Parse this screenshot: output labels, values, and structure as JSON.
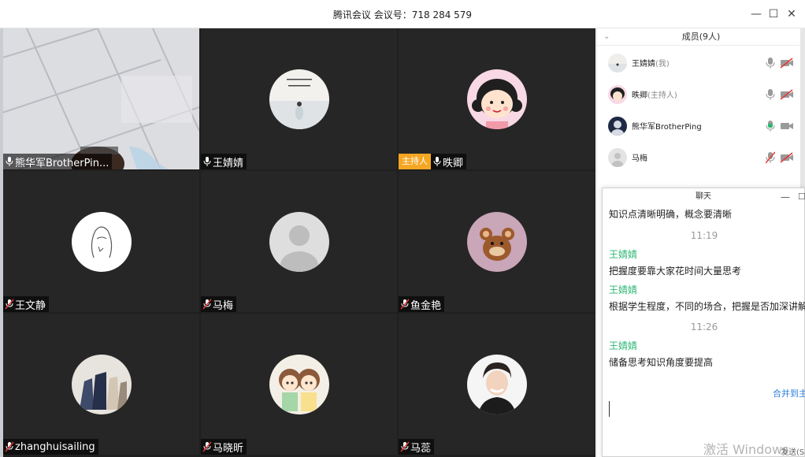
{
  "window": {
    "title": "腾讯会议 会议号：718 284 579",
    "minimize": "—",
    "maximize": "☐",
    "close": "✕"
  },
  "tiles": [
    {
      "name": "熊华军BrotherPin...",
      "mic": "on",
      "host": false,
      "avatar": "camera-feed"
    },
    {
      "name": "王婧婧",
      "mic": "on",
      "host": false,
      "avatar": "girl-beach-photo"
    },
    {
      "name": "昳卿",
      "mic": "on",
      "host": true,
      "host_label": "主持人",
      "avatar": "cartoon-girl"
    },
    {
      "name": "王文静",
      "mic": "muted",
      "host": false,
      "avatar": "line-sketch"
    },
    {
      "name": "马梅",
      "mic": "muted",
      "host": false,
      "avatar": "default-person"
    },
    {
      "name": "鱼金艳",
      "mic": "muted",
      "host": false,
      "avatar": "cartoon-mouse"
    },
    {
      "name": "zhanghuisailing",
      "mic": "muted",
      "host": false,
      "avatar": "horse-figurines"
    },
    {
      "name": "马晓昕",
      "mic": "muted",
      "host": false,
      "avatar": "anime-twins"
    },
    {
      "name": "马蕊",
      "mic": "muted",
      "host": false,
      "avatar": "young-man-photo"
    }
  ],
  "members": {
    "header": "成员(9人)",
    "items": [
      {
        "name": "王婧婧",
        "role": "(我)",
        "mic": "on",
        "cam": "off",
        "avatar": "girl-beach-photo"
      },
      {
        "name": "昳卿",
        "role": "(主持人)",
        "mic": "on",
        "cam": "off",
        "avatar": "cartoon-girl"
      },
      {
        "name": "熊华军BrotherPing",
        "role": "",
        "mic": "active",
        "cam": "on",
        "avatar": "dark-avatar"
      },
      {
        "name": "马梅",
        "role": "",
        "mic": "muted",
        "cam": "off",
        "avatar": "default-person"
      }
    ]
  },
  "chat": {
    "title": "聊天",
    "minimize": "—",
    "maximize": "☐",
    "messages": [
      {
        "kind": "text",
        "text": "知识点清晰明确，概念要清晰"
      },
      {
        "kind": "time",
        "text": "11:19"
      },
      {
        "kind": "sender",
        "text": "王婧婧"
      },
      {
        "kind": "text",
        "text": "把握度要靠大家花时间大量思考"
      },
      {
        "kind": "sender",
        "text": "王婧婧"
      },
      {
        "kind": "text",
        "text": "根据学生程度，不同的场合，把握是否加深讲解内"
      },
      {
        "kind": "time",
        "text": "11:26"
      },
      {
        "kind": "sender",
        "text": "王婧婧"
      },
      {
        "kind": "text",
        "text": "储备思考知识角度要提高"
      }
    ],
    "merge_link": "合并到主",
    "send_hint": "发送(S",
    "watermark": "激活 Windows"
  },
  "colors": {
    "sender": "#2bb673",
    "host_badge": "#f5a623",
    "link": "#2e7fdb",
    "grid_bg": "#1f1f1f"
  }
}
